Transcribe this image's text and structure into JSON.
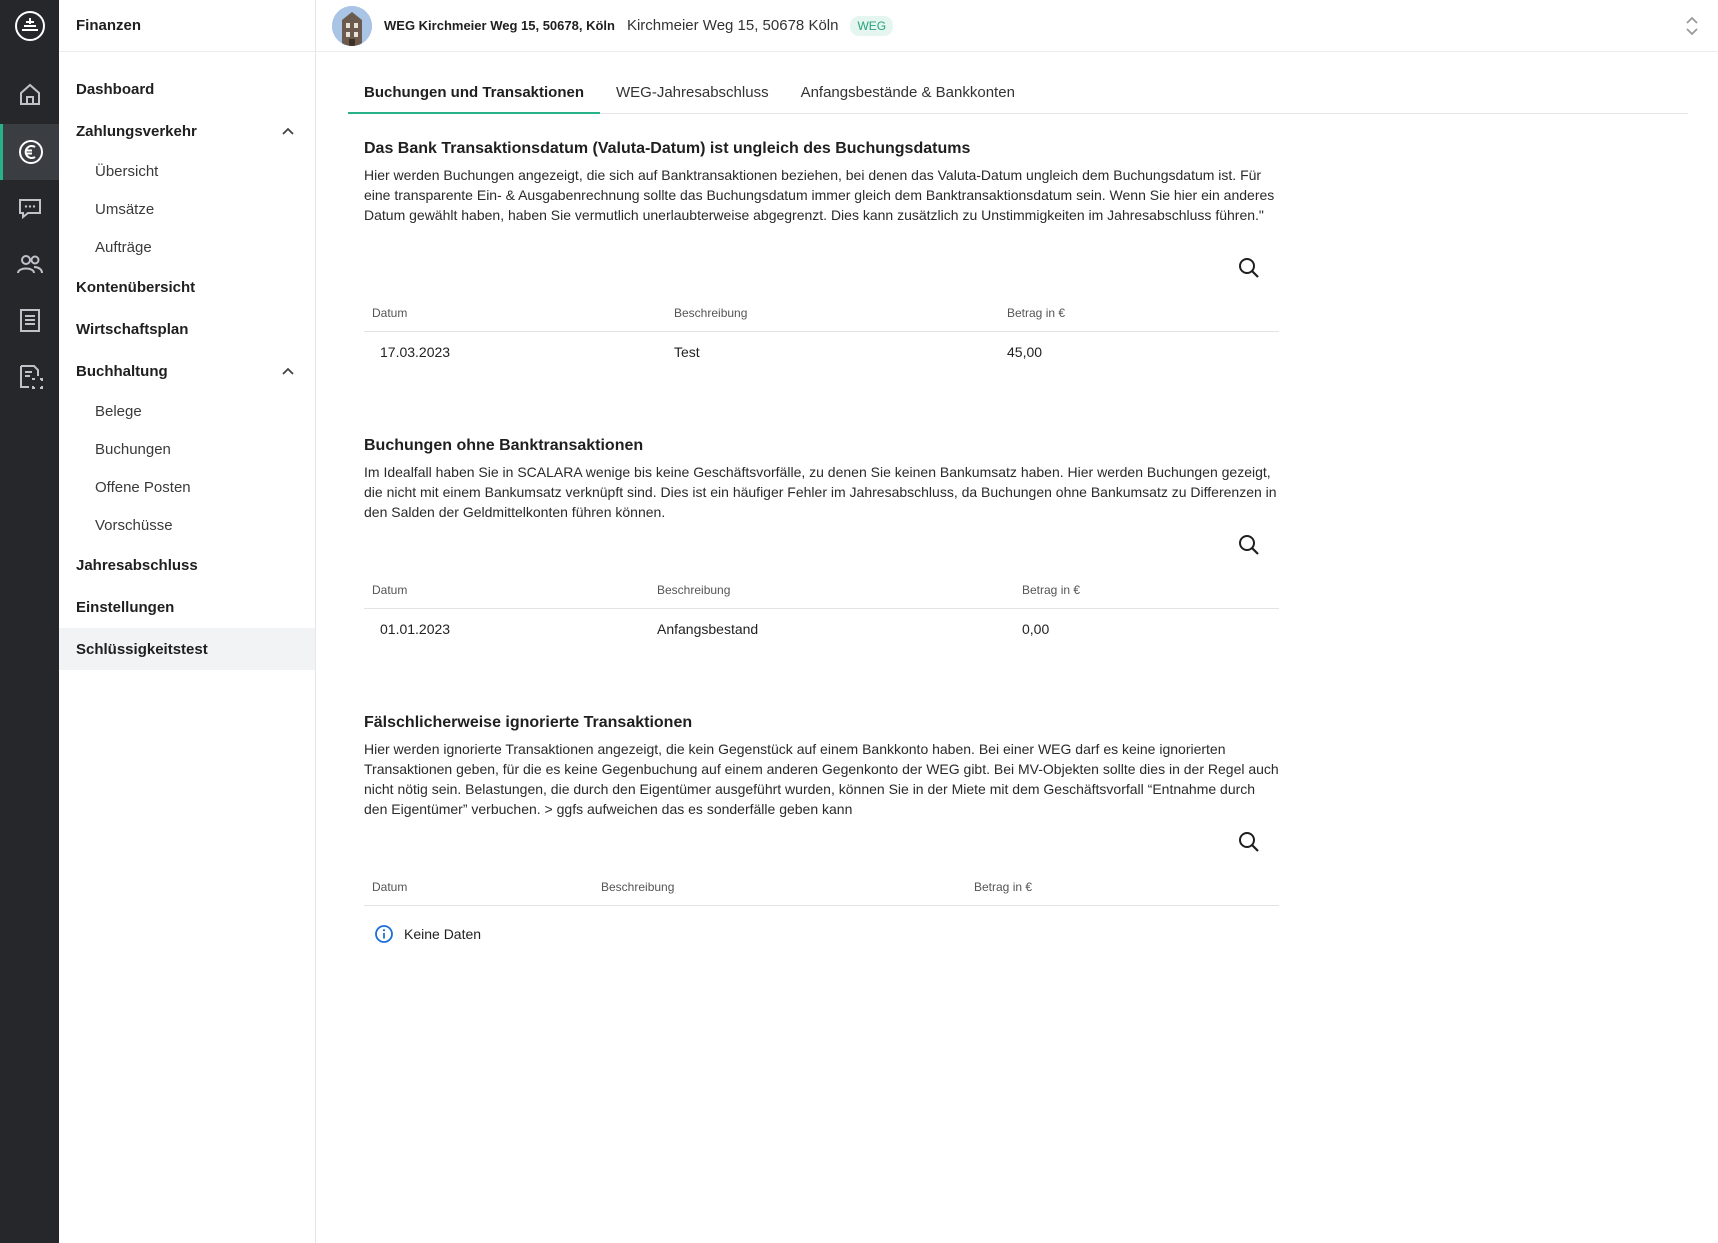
{
  "app": {
    "section_title": "Finanzen"
  },
  "rail": {
    "items": [
      {
        "icon": "home-icon"
      },
      {
        "icon": "euro-icon",
        "active": true
      },
      {
        "icon": "chat-icon"
      },
      {
        "icon": "users-icon"
      },
      {
        "icon": "document-list-icon"
      },
      {
        "icon": "document-scan-icon"
      }
    ]
  },
  "sidebar": {
    "items": {
      "dashboard": "Dashboard",
      "zahlungsverkehr": "Zahlungsverkehr",
      "uebersicht": "Übersicht",
      "umsaetze": "Umsätze",
      "auftraege": "Aufträge",
      "kontenuebersicht": "Kontenübersicht",
      "wirtschaftsplan": "Wirtschaftsplan",
      "buchhaltung": "Buchhaltung",
      "belege": "Belege",
      "buchungen": "Buchungen",
      "offene_posten": "Offene Posten",
      "vorschuesse": "Vorschüsse",
      "jahresabschluss": "Jahresabschluss",
      "einstellungen": "Einstellungen",
      "schluessigkeitstest": "Schlüssigkeitstest"
    }
  },
  "topbar": {
    "property_name": "WEG Kirchmeier Weg 15, 50678, Köln",
    "property_address": "Kirchmeier Weg 15, 50678 Köln",
    "badge": "WEG"
  },
  "tabs": [
    {
      "label": "Buchungen und Transaktionen",
      "active": true
    },
    {
      "label": "WEG-Jahresabschluss"
    },
    {
      "label": "Anfangsbestände & Bankkonten"
    }
  ],
  "sections": [
    {
      "title": "Das Bank Transaktionsdatum (Valuta-Datum) ist ungleich des Buchungsdatums",
      "description": "Hier werden Buchungen angezeigt, die sich auf Banktransaktionen beziehen, bei denen das Valuta-Datum ungleich dem Buchungsdatum ist. Für eine transparente Ein- & Ausgabenrechnung sollte das Buchungsdatum immer gleich dem Banktransaktionsdatum sein. Wenn Sie hier ein anderes Datum gewählt haben, haben Sie vermutlich unerlaubterweise abgegrenzt. Dies kann zusätzlich zu Unstimmigkeiten im Jahresabschluss führen.\"",
      "columns": [
        "Datum",
        "Beschreibung",
        "Betrag in €"
      ],
      "rows": [
        [
          "17.03.2023",
          "Test",
          "45,00"
        ]
      ]
    },
    {
      "title": "Buchungen ohne Banktransaktionen",
      "description": "Im Idealfall haben Sie in SCALARA wenige bis keine Geschäftsvorfälle, zu denen Sie keinen Bankumsatz haben. Hier werden Buchungen gezeigt, die nicht mit einem Bankumsatz verknüpft sind. Dies ist ein häufiger Fehler im Jahresabschluss, da Buchungen ohne Bankumsatz zu Differenzen in den Salden der Geldmittelkonten führen können.",
      "columns": [
        "Datum",
        "Beschreibung",
        "Betrag in €"
      ],
      "rows": [
        [
          "01.01.2023",
          "Anfangsbestand",
          "0,00"
        ]
      ]
    },
    {
      "title": "Fälschlicherweise ignorierte Transaktionen",
      "description": "Hier werden ignorierte Transaktionen angezeigt, die kein Gegenstück auf einem Bankkonto haben. Bei einer WEG darf es keine ignorierten Transaktionen geben, für die es keine Gegenbuchung auf einem anderen Gegenkonto der WEG gibt. Bei MV-Objekten sollte dies in der Regel auch nicht nötig sein. Belastungen, die durch den Eigentümer ausgeführt wurden, können Sie in der Miete mit dem Geschäftsvorfall “Entnahme durch den Eigentümer” verbuchen. > ggfs aufweichen das es sonderfälle geben kann",
      "columns": [
        "Datum",
        "Beschreibung",
        "Betrag in €"
      ],
      "empty_text": "Keine Daten"
    }
  ],
  "colors": {
    "accent": "#27b28a",
    "rail_bg": "#25272b",
    "info": "#1a6fd6"
  }
}
